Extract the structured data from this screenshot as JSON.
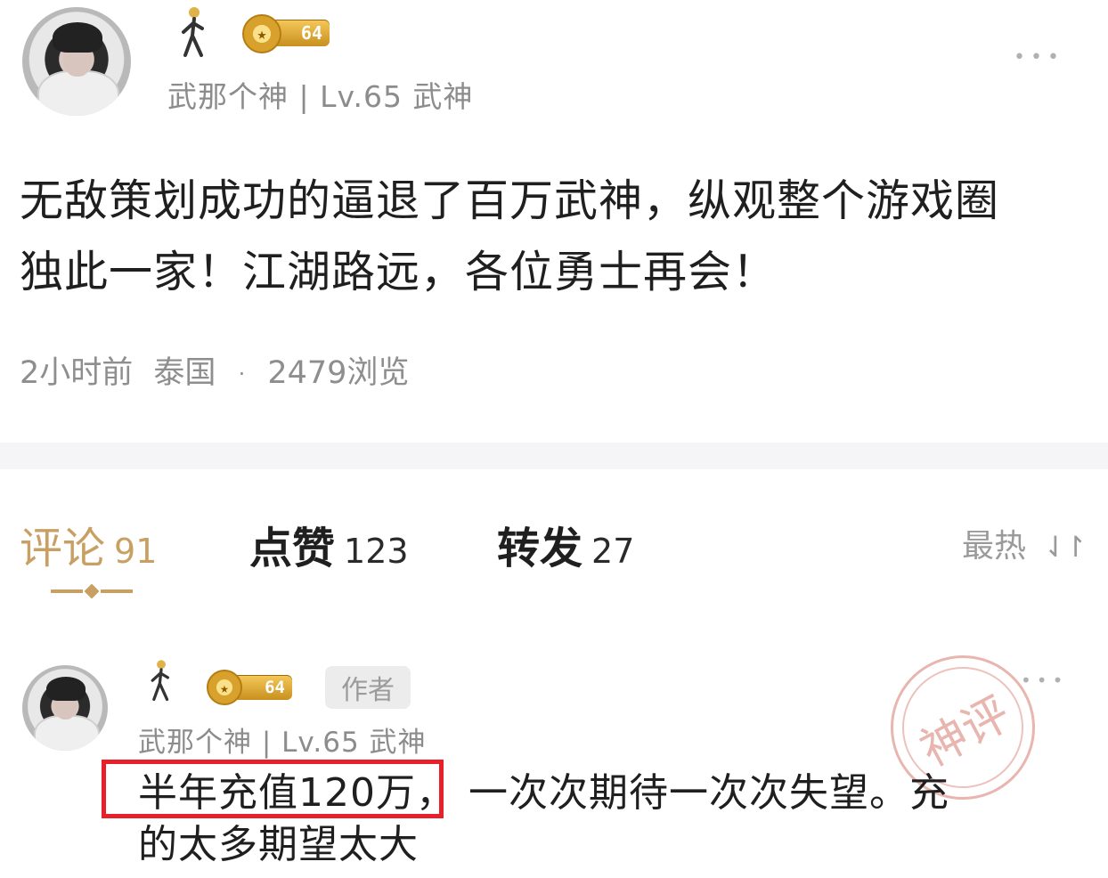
{
  "post": {
    "author_name": "武那个神",
    "level_text": "Lv.65 武神",
    "badge_level": "64",
    "more_icon": "more-dots-icon",
    "text_line1": "无敌策划成功的逼退了百万武神，纵观整个游戏圈",
    "text_line2": "独此一家！江湖路远，各位勇士再会！",
    "time_ago": "2小时前",
    "location": "泰国",
    "views": "2479浏览"
  },
  "tabs": [
    {
      "label": "评论",
      "count": "91",
      "active": true
    },
    {
      "label": "点赞",
      "count": "123",
      "active": false
    },
    {
      "label": "转发",
      "count": "27",
      "active": false
    }
  ],
  "sort": {
    "label": "最热",
    "icon": "sort-arrows-icon"
  },
  "comment": {
    "author_name": "武那个神",
    "level_text": "Lv.65 武神",
    "badge_level": "64",
    "author_tag": "作者",
    "stamp_text": "神评",
    "highlighted_text": "半年充值120万，",
    "text_rest_line1": "一次次期待一次次失望。充",
    "text_line2": "的太多期望太大"
  },
  "colors": {
    "accent_gold": "#c9a064",
    "highlight_red": "#e8202a",
    "stamp_red": "#d6786e"
  }
}
